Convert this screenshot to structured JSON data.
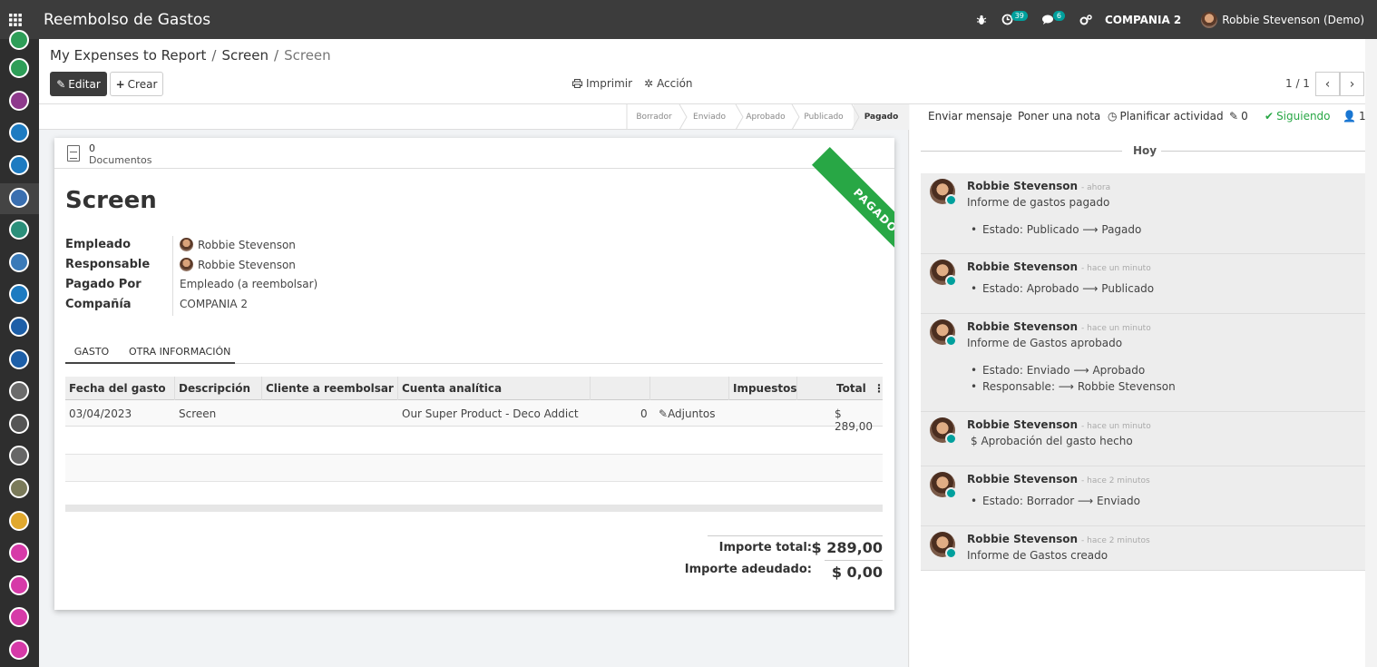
{
  "topbar": {
    "app_title": "Reembolso de Gastos",
    "activity_count": "39",
    "message_count": "6",
    "company": "COMPANIA 2",
    "user": "Robbie Stevenson (Demo)"
  },
  "breadcrumb": {
    "items": [
      "My Expenses to Report",
      "Screen",
      "Screen"
    ],
    "separator": "/"
  },
  "toolbar": {
    "edit_label": "Editar",
    "create_label": "Crear",
    "print_label": "Imprimir",
    "action_label": "Acción",
    "pager": "1 / 1"
  },
  "status_steps": [
    "Borrador",
    "Enviado",
    "Aprobado",
    "Publicado",
    "Pagado"
  ],
  "form": {
    "doc_count": "0",
    "doc_label": "Documentos",
    "ribbon": "PAGADO",
    "title": "Screen",
    "fields": [
      {
        "label": "Empleado",
        "value": "Robbie Stevenson"
      },
      {
        "label": "Responsable",
        "value": "Robbie Stevenson"
      },
      {
        "label": "Pagado Por",
        "value": "Empleado (a reembolsar)"
      },
      {
        "label": "Compañía",
        "value": "COMPANIA 2"
      }
    ],
    "tabs": [
      "GASTO",
      "OTRA INFORMACIÓN"
    ],
    "columns": [
      "Fecha del gasto",
      "Descripción",
      "Cliente a reembolsar",
      "Cuenta analítica",
      "",
      "",
      "Impuestos",
      "Total"
    ],
    "rows": [
      {
        "date": "03/04/2023",
        "description": "Screen",
        "client": "",
        "analytic": "Our Super Product - Deco Addict",
        "qty": "0",
        "attach": "Adjuntos",
        "taxes": "",
        "total": "$ 289,00"
      }
    ],
    "totals": {
      "total_label": "Importe total:",
      "total_value": "$ 289,00",
      "due_label": "Importe adeudado:",
      "due_value": "$ 0,00"
    }
  },
  "chatter": {
    "send_message": "Enviar mensaje",
    "log_note": "Poner una nota",
    "schedule": "Planificar actividad",
    "attachments": "0",
    "following": "Siguiendo",
    "followers": "1",
    "date_sep": "Hoy",
    "messages": [
      {
        "author": "Robbie Stevenson",
        "time": "- ahora",
        "body": "Informe de gastos pagado",
        "items": [
          "Estado: Publicado ⟶ Pagado"
        ]
      },
      {
        "author": "Robbie Stevenson",
        "time": "- hace un minuto",
        "body": "",
        "items": [
          "Estado: Aprobado ⟶ Publicado"
        ]
      },
      {
        "author": "Robbie Stevenson",
        "time": "- hace un minuto",
        "body": "Informe de Gastos aprobado",
        "items": [
          "Estado: Enviado ⟶ Aprobado",
          "Responsable: ⟶ Robbie Stevenson"
        ]
      },
      {
        "author": "Robbie Stevenson",
        "time": "- hace un minuto",
        "body": "$ Aprobación del gasto hecho",
        "items": []
      },
      {
        "author": "Robbie Stevenson",
        "time": "- hace 2 minutos",
        "body": "",
        "items": [
          "Estado: Borrador ⟶ Enviado"
        ]
      },
      {
        "author": "Robbie Stevenson",
        "time": "- hace 2 minutos",
        "body": "Informe de Gastos creado",
        "items": []
      }
    ]
  },
  "colors": {
    "topbar": "#3c3c3c",
    "ribbon": "#28a745",
    "following": "#28a745",
    "presence": "#00a09d"
  }
}
